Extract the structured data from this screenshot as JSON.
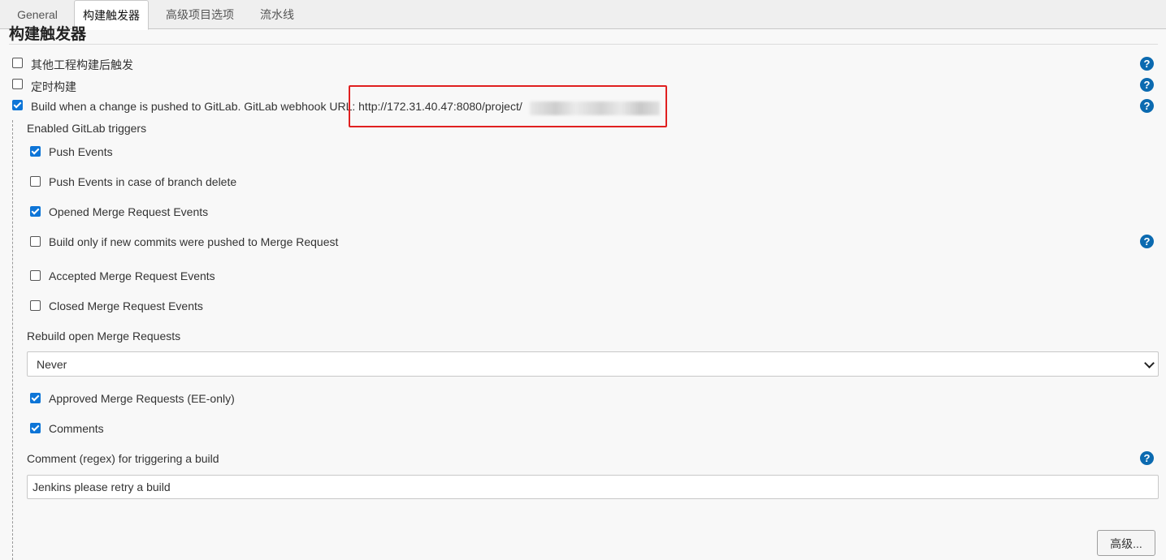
{
  "tabs": [
    {
      "label": "General",
      "active": false
    },
    {
      "label": "构建触发器",
      "active": true
    },
    {
      "label": "高级项目选项",
      "active": false
    },
    {
      "label": "流水线",
      "active": false
    }
  ],
  "section": {
    "title": "构建触发器"
  },
  "triggers": [
    {
      "label": "其他工程构建后触发",
      "checked": false,
      "help_icon": "help-icon"
    },
    {
      "label": "定时构建",
      "checked": false,
      "help_icon": "help-icon"
    },
    {
      "label": "Build when a change is pushed to GitLab. GitLab webhook URL: http://172.31.40.47:8080/project/",
      "checked": true,
      "help_icon": "help-icon"
    }
  ],
  "gitlab": {
    "enabled_triggers_label": "Enabled GitLab triggers",
    "options": [
      {
        "label": "Push Events",
        "checked": true
      },
      {
        "label": "Push Events in case of branch delete",
        "checked": false
      },
      {
        "label": "Opened Merge Request Events",
        "checked": true
      },
      {
        "label": "Build only if new commits were pushed to Merge Request",
        "checked": false
      },
      {
        "label": "Accepted Merge Request Events",
        "checked": false
      },
      {
        "label": "Closed Merge Request Events",
        "checked": false
      }
    ],
    "rebuild_label": "Rebuild open Merge Requests",
    "rebuild_value": "Never",
    "options2": [
      {
        "label": "Approved Merge Requests (EE-only)",
        "checked": true
      },
      {
        "label": "Comments",
        "checked": true
      }
    ],
    "comment_regex_label": "Comment (regex) for triggering a build",
    "comment_regex_value": "Jenkins please retry a build"
  },
  "advanced_button": "高级...",
  "colors": {
    "accent": "#0e75d7",
    "help": "#0b6ab0",
    "highlight": "#e02020"
  }
}
